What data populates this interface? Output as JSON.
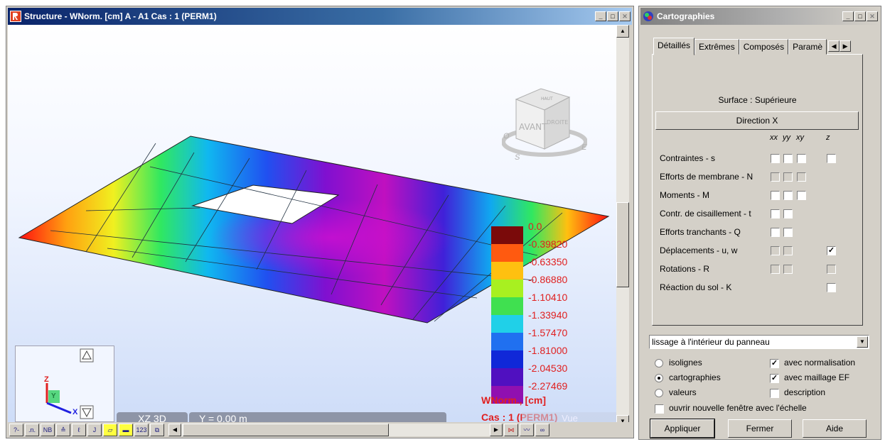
{
  "left_window": {
    "title": "Structure - WNorm. [cm] A - A1 Cas : 1 (PERM1)",
    "view_label": "XZ 3D",
    "y_label": "Y = 0.00 m",
    "vue_label": "Vue",
    "view_cube": {
      "front": "AVANT",
      "right": "DROITE",
      "top": "HAUT",
      "compass": [
        "O",
        "S",
        "E"
      ]
    },
    "axes": [
      "Z",
      "Y",
      "X"
    ],
    "legend": {
      "values": [
        "0.0",
        "-0.39820",
        "-0.63350",
        "-0.86880",
        "-1.10410",
        "-1.33940",
        "-1.57470",
        "-1.81000",
        "-2.04530",
        "-2.27469"
      ],
      "colors": [
        "#7a0a0a",
        "#ff5a10",
        "#ffc010",
        "#a8f020",
        "#40e050",
        "#20d0e8",
        "#2070f0",
        "#1028d8",
        "#5010c0",
        "#9010b0"
      ],
      "unit": "WNorm., [cm]",
      "case": "Cas : 1 (PERM1)"
    },
    "toolbar": [
      "?-",
      ".n.",
      "NB",
      "≙",
      "ℓ",
      "J",
      "▱",
      "▬",
      "123",
      "⧉"
    ]
  },
  "right_window": {
    "title": "Cartographies",
    "tabs": [
      "Détaillés",
      "Extrêmes",
      "Composés",
      "Paramè"
    ],
    "surface": "Surface : Supérieure",
    "direction": "Direction X",
    "columns": [
      "xx",
      "yy",
      "xy",
      "z"
    ],
    "rows": [
      {
        "label": "Contraintes - s",
        "cbs": [
          0,
          0,
          0,
          0
        ],
        "has": [
          1,
          1,
          1,
          1
        ]
      },
      {
        "label": "Efforts de membrane - N",
        "cbs": [
          0,
          0,
          0,
          0
        ],
        "has": [
          1,
          1,
          1,
          0
        ]
      },
      {
        "label": "Moments - M",
        "cbs": [
          0,
          0,
          0,
          0
        ],
        "has": [
          1,
          1,
          1,
          0
        ]
      },
      {
        "label": "Contr. de cisaillement - t",
        "cbs": [
          0,
          0,
          0,
          0
        ],
        "has": [
          1,
          1,
          0,
          0
        ]
      },
      {
        "label": "Efforts tranchants - Q",
        "cbs": [
          0,
          0,
          0,
          0
        ],
        "has": [
          1,
          1,
          0,
          0
        ]
      },
      {
        "label": "Déplacements - u, w",
        "cbs": [
          0,
          0,
          0,
          1
        ],
        "has": [
          1,
          1,
          0,
          1
        ]
      },
      {
        "label": "Rotations - R",
        "cbs": [
          0,
          0,
          0,
          0
        ],
        "has": [
          1,
          1,
          0,
          1
        ]
      },
      {
        "label": "Réaction du sol - K",
        "cbs": [
          0,
          0,
          0,
          0
        ],
        "has": [
          0,
          0,
          0,
          1
        ]
      }
    ],
    "smoothing": "lissage à l'intérieur du panneau",
    "modes": [
      {
        "label": "isolignes",
        "selected": false
      },
      {
        "label": "cartographies",
        "selected": true
      },
      {
        "label": "valeurs",
        "selected": false
      }
    ],
    "options": [
      {
        "label": "avec normalisation",
        "checked": true
      },
      {
        "label": "avec maillage EF",
        "checked": true
      },
      {
        "label": "description",
        "checked": false
      }
    ],
    "new_window": {
      "label": "ouvrir nouvelle fenêtre avec l'échelle",
      "checked": false
    },
    "buttons": {
      "apply": "Appliquer",
      "close": "Fermer",
      "help": "Aide"
    }
  }
}
